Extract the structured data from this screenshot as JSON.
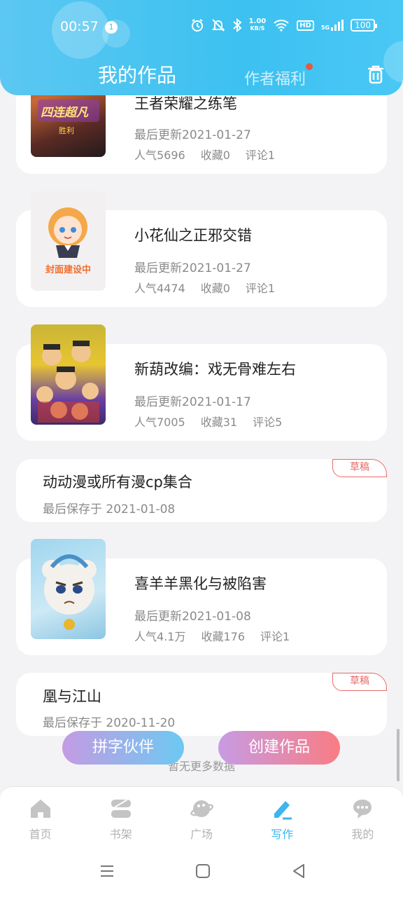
{
  "status_bar": {
    "time": "00:57",
    "notification_count": "1",
    "net_speed": "1.00",
    "net_unit": "KB/S",
    "hd": "HD",
    "network": "5G",
    "battery": "100"
  },
  "header": {
    "title": "我的作品",
    "welfare_tab": "作者福利",
    "accent_color": "#3cc1f0"
  },
  "works": [
    {
      "title": "王者荣耀之练笔",
      "updated": "最后更新2021-01-27",
      "popularity": "人气5696",
      "favorites": "收藏0",
      "comments": "评论1",
      "cover_text": "四连超凡",
      "cover_sub": "胜利"
    },
    {
      "title": "小花仙之正邪交错",
      "updated": "最后更新2021-01-27",
      "popularity": "人气4474",
      "favorites": "收藏0",
      "comments": "评论1",
      "cover_text": "封面建设中"
    },
    {
      "title": "新葫改编：戏无骨难左右",
      "updated": "最后更新2021-01-17",
      "popularity": "人气7005",
      "favorites": "收藏31",
      "comments": "评论5"
    }
  ],
  "drafts": [
    {
      "title": "动动漫或所有漫cp集合",
      "saved": "最后保存于 2021-01-08",
      "badge": "草稿"
    },
    {
      "title": "凰与江山",
      "saved": "最后保存于 2020-11-20",
      "badge": "草稿"
    }
  ],
  "work4": {
    "title": "喜羊羊黑化与被陷害",
    "updated": "最后更新2021-01-08",
    "popularity": "人气4.1万",
    "favorites": "收藏176",
    "comments": "评论1"
  },
  "actions": {
    "partner": "拼字伙伴",
    "create": "创建作品"
  },
  "no_more": "暂无更多数据",
  "nav": [
    {
      "label": "首页",
      "icon": "home-icon"
    },
    {
      "label": "书架",
      "icon": "bookshelf-icon"
    },
    {
      "label": "广场",
      "icon": "planet-icon"
    },
    {
      "label": "写作",
      "icon": "pen-icon",
      "active": true
    },
    {
      "label": "我的",
      "icon": "chat-bubble-icon"
    }
  ]
}
